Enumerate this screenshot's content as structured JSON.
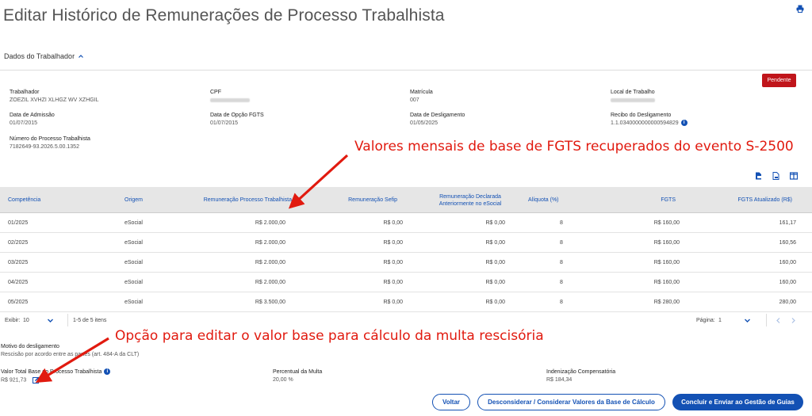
{
  "page": {
    "title": "Editar Histórico de Remunerações de Processo Trabalhista",
    "section_label": "Dados do Trabalhador",
    "status_badge": "Pendente"
  },
  "worker": {
    "trabalhador_label": "Trabalhador",
    "trabalhador_value": "ZOEZIL XVHZI XLHGZ WV XZHGIL",
    "cpf_label": "CPF",
    "matricula_label": "Matrícula",
    "matricula_value": "007",
    "local_label": "Local de Trabalho",
    "admissao_label": "Data de Admissão",
    "admissao_value": "01/07/2015",
    "opcao_label": "Data de Opção FGTS",
    "opcao_value": "01/07/2015",
    "desligamento_label": "Data de Desligamento",
    "desligamento_value": "01/05/2025",
    "recibo_label": "Recibo do Desligamento",
    "recibo_value": "1.1.0340000000000594829",
    "processo_label": "Número do Processo Trabalhista",
    "processo_value": "7182649-93.2026.5.00.1352"
  },
  "table": {
    "headers": {
      "competencia": "Competência",
      "origem": "Origem",
      "rem_processo": "Remuneração Processo Trabalhista",
      "rem_sefip": "Remuneração Sefip",
      "rem_declarada": "Remuneração Declarada Anteriormente no eSocial",
      "aliquota": "Alíquota (%)",
      "fgts": "FGTS",
      "fgts_atualizado": "FGTS Atualizado (R$)"
    },
    "rows": [
      {
        "competencia": "01/2025",
        "origem": "eSocial",
        "rem_processo": "R$ 2.000,00",
        "rem_sefip": "R$ 0,00",
        "rem_declarada": "R$ 0,00",
        "aliquota": "8",
        "fgts": "R$ 160,00",
        "fgts_atualizado": "161,17"
      },
      {
        "competencia": "02/2025",
        "origem": "eSocial",
        "rem_processo": "R$ 2.000,00",
        "rem_sefip": "R$ 0,00",
        "rem_declarada": "R$ 0,00",
        "aliquota": "8",
        "fgts": "R$ 160,00",
        "fgts_atualizado": "160,56"
      },
      {
        "competencia": "03/2025",
        "origem": "eSocial",
        "rem_processo": "R$ 2.000,00",
        "rem_sefip": "R$ 0,00",
        "rem_declarada": "R$ 0,00",
        "aliquota": "8",
        "fgts": "R$ 160,00",
        "fgts_atualizado": "160,00"
      },
      {
        "competencia": "04/2025",
        "origem": "eSocial",
        "rem_processo": "R$ 2.000,00",
        "rem_sefip": "R$ 0,00",
        "rem_declarada": "R$ 0,00",
        "aliquota": "8",
        "fgts": "R$ 160,00",
        "fgts_atualizado": "160,00"
      },
      {
        "competencia": "05/2025",
        "origem": "eSocial",
        "rem_processo": "R$ 3.500,00",
        "rem_sefip": "R$ 0,00",
        "rem_declarada": "R$ 0,00",
        "aliquota": "8",
        "fgts": "R$ 280,00",
        "fgts_atualizado": "280,00"
      }
    ]
  },
  "pager": {
    "exibir_label": "Exibir:",
    "exibir_value": "10",
    "range_text": "1-5 de 5 itens",
    "pagina_label": "Página:",
    "pagina_value": "1"
  },
  "footer": {
    "motivo_label": "Motivo do desligamento",
    "motivo_value": "Rescisão por acordo entre as partes (art. 484-A da CLT)",
    "valor_label": "Valor Total Base do Processo Trabalhista",
    "valor_value": "R$ 921,73",
    "percentual_label": "Percentual da Multa",
    "percentual_value": "20,00 %",
    "indenizacao_label": "Indenização Compensatória",
    "indenizacao_value": "R$ 184,34"
  },
  "buttons": {
    "voltar": "Voltar",
    "desconsiderar": "Desconsiderar / Considerar Valores da Base de Cálculo",
    "concluir": "Concluir e Enviar ao Gestão de Guias"
  },
  "annotations": {
    "top": "Valores mensais de base de FGTS recuperados do evento S-2500",
    "bottom": "Opção para editar o valor base para cálculo da multa rescisória"
  },
  "colors": {
    "primary": "#1351b4",
    "badge": "#c0151b",
    "annotation": "#e11a0f"
  }
}
